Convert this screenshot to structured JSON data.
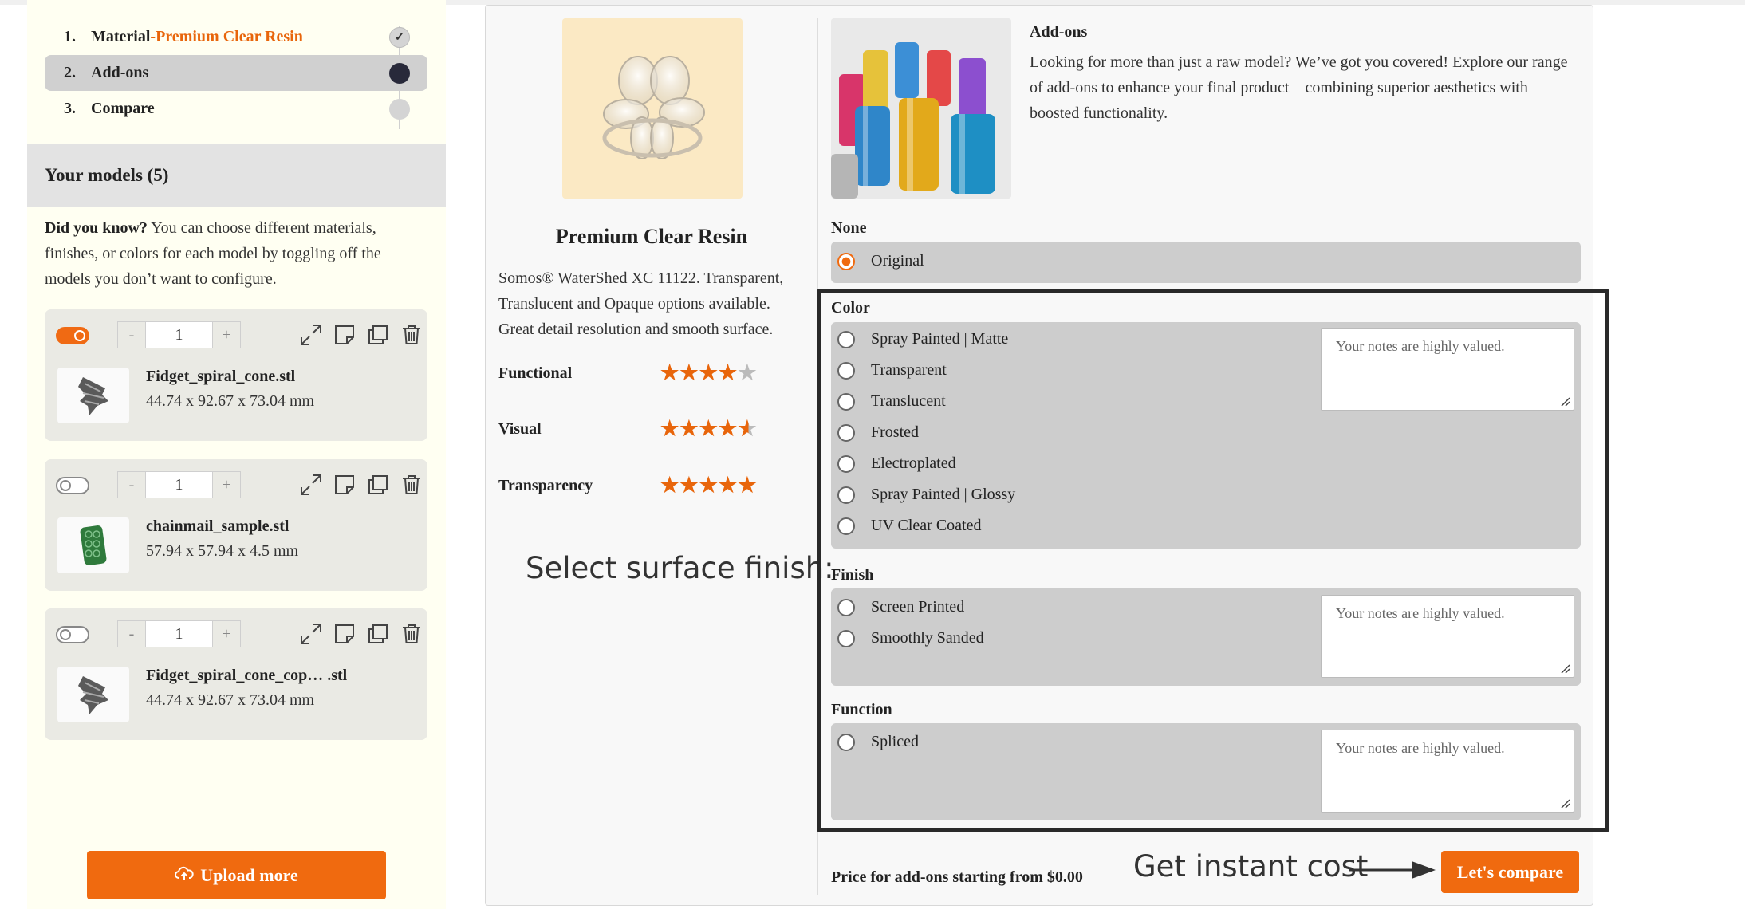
{
  "steps": [
    {
      "num": "1.",
      "label": "Material",
      "sep": " - ",
      "value": "Premium Clear Resin",
      "status": "done"
    },
    {
      "num": "2.",
      "label": "Add-ons",
      "status": "current"
    },
    {
      "num": "3.",
      "label": "Compare",
      "status": "pending"
    }
  ],
  "models_header": "Your models (5)",
  "tip": {
    "bold": "Did you know?",
    "text": " You can choose different materials, finishes, or colors for each model by toggling off the models you don’t want to configure."
  },
  "models": [
    {
      "enabled": true,
      "qty": "1",
      "name": "Fidget_spiral_cone.stl",
      "dims": "44.74 x 92.67 x 73.04 mm"
    },
    {
      "enabled": false,
      "qty": "1",
      "name": "chainmail_sample.stl",
      "dims": "57.94 x 57.94 x 4.5 mm"
    },
    {
      "enabled": false,
      "qty": "1",
      "name": "Fidget_spiral_cone_cop… .stl",
      "dims": "44.74 x 92.67 x 73.04 mm"
    }
  ],
  "qty_minus": "-",
  "qty_plus": "+",
  "upload_label": "Upload more",
  "material": {
    "title": "Premium Clear Resin",
    "description": "Somos® WaterShed XC 11122. Transparent, Translucent and Opaque options available. Great detail resolution and smooth surface.",
    "ratings": [
      {
        "label": "Functional",
        "value": 4
      },
      {
        "label": "Visual",
        "value": 4.5
      },
      {
        "label": "Transparency",
        "value": 5
      }
    ]
  },
  "callout_finish": "Select surface finish:",
  "addons": {
    "title": "Add-ons",
    "description": "Looking for more than just a raw model? We’ve got you covered! Explore our range of add-ons to enhance your final product—combining superior aesthetics with boosted functionality.",
    "none": {
      "label": "None",
      "options": [
        "Original"
      ],
      "selected": "Original"
    },
    "color": {
      "label": "Color",
      "options": [
        "Spray Painted | Matte",
        "Transparent",
        "Translucent",
        "Frosted",
        "Electroplated",
        "Spray Painted | Glossy",
        "UV Clear Coated"
      ]
    },
    "finish": {
      "label": "Finish",
      "options": [
        "Screen Printed",
        "Smoothly Sanded"
      ]
    },
    "function": {
      "label": "Function",
      "options": [
        "Spliced"
      ]
    },
    "notes_placeholder": "Your notes are highly valued."
  },
  "price_text": "Price for add-ons starting from $0.00",
  "callout_cost": "Get instant cost",
  "compare_label": "Let's compare",
  "colors": {
    "accent": "#f06a0f",
    "dark": "#28293a"
  }
}
